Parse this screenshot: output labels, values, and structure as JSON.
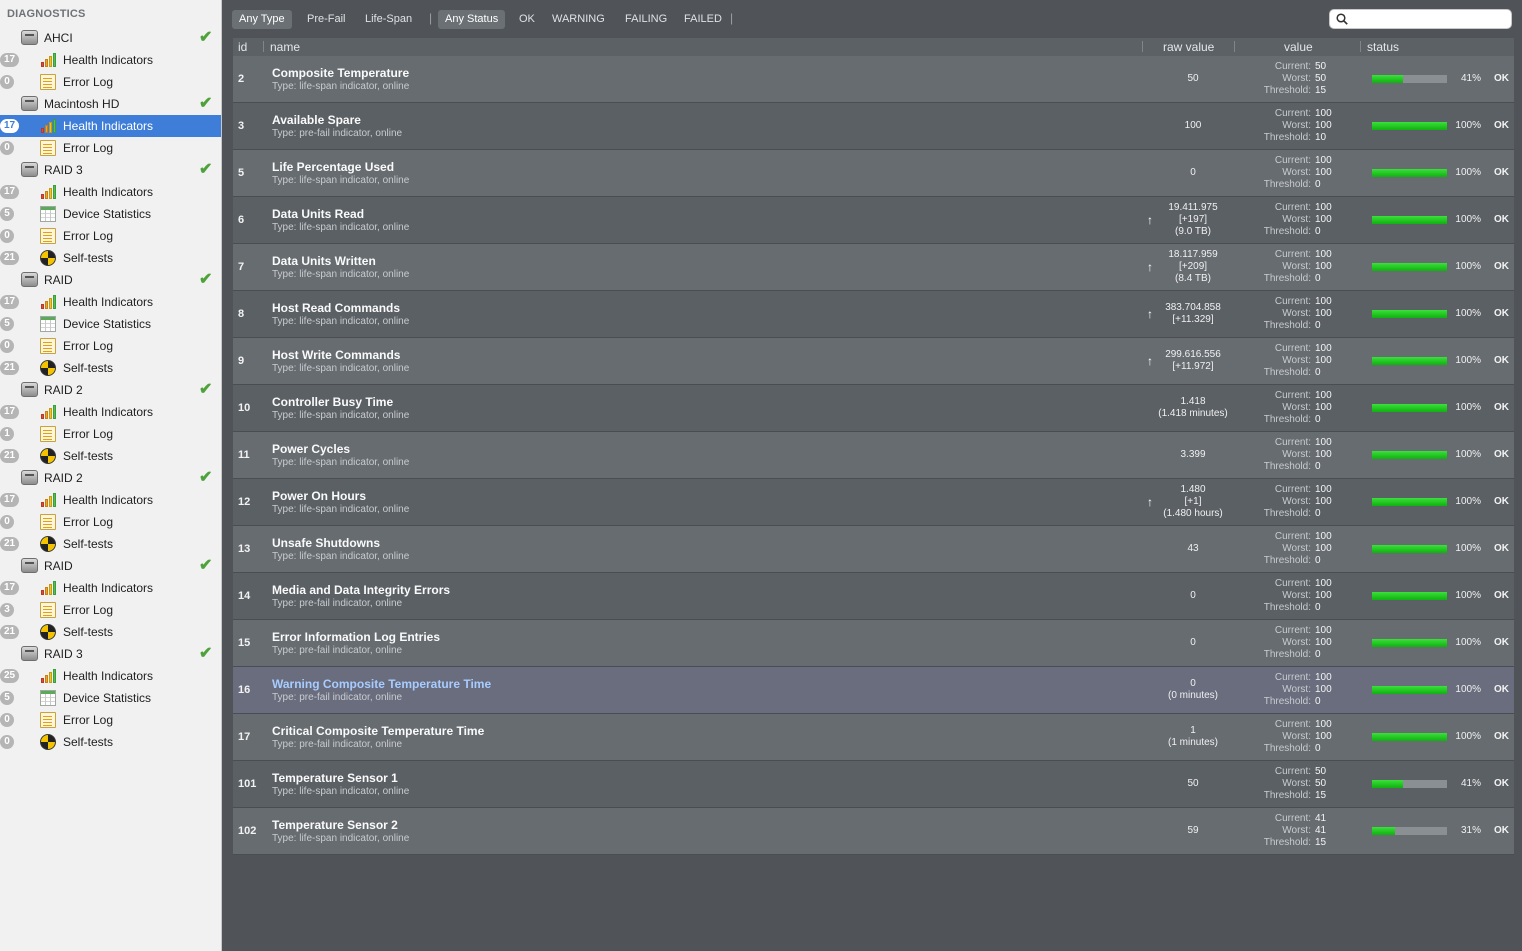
{
  "sidebar": {
    "title": "DIAGNOSTICS",
    "items": [
      {
        "kind": "disk",
        "label": "AHCI",
        "check": "✔"
      },
      {
        "kind": "child",
        "icon": "health",
        "label": "Health Indicators",
        "badge": "17"
      },
      {
        "kind": "child",
        "icon": "doc",
        "label": "Error Log",
        "badge": "0"
      },
      {
        "kind": "disk",
        "label": "Macintosh HD",
        "check": "✔"
      },
      {
        "kind": "child",
        "icon": "health",
        "label": "Health Indicators",
        "badge": "17",
        "selected": true
      },
      {
        "kind": "child",
        "icon": "doc",
        "label": "Error Log",
        "badge": "0"
      },
      {
        "kind": "disk",
        "label": "RAID 3",
        "check": "✔"
      },
      {
        "kind": "child",
        "icon": "health",
        "label": "Health Indicators",
        "badge": "17"
      },
      {
        "kind": "child",
        "icon": "stats",
        "label": "Device Statistics",
        "badge": "5"
      },
      {
        "kind": "child",
        "icon": "doc",
        "label": "Error Log",
        "badge": "0"
      },
      {
        "kind": "child",
        "icon": "self",
        "label": "Self-tests",
        "badge": "21"
      },
      {
        "kind": "disk",
        "label": "RAID",
        "check": "✔"
      },
      {
        "kind": "child",
        "icon": "health",
        "label": "Health Indicators",
        "badge": "17"
      },
      {
        "kind": "child",
        "icon": "stats",
        "label": "Device Statistics",
        "badge": "5"
      },
      {
        "kind": "child",
        "icon": "doc",
        "label": "Error Log",
        "badge": "0"
      },
      {
        "kind": "child",
        "icon": "self",
        "label": "Self-tests",
        "badge": "21"
      },
      {
        "kind": "disk",
        "label": "RAID 2",
        "check": "✔"
      },
      {
        "kind": "child",
        "icon": "health",
        "label": "Health Indicators",
        "badge": "17"
      },
      {
        "kind": "child",
        "icon": "doc",
        "label": "Error Log",
        "badge": "1"
      },
      {
        "kind": "child",
        "icon": "self",
        "label": "Self-tests",
        "badge": "21"
      },
      {
        "kind": "disk",
        "label": "RAID 2",
        "check": "✔"
      },
      {
        "kind": "child",
        "icon": "health",
        "label": "Health Indicators",
        "badge": "17"
      },
      {
        "kind": "child",
        "icon": "doc",
        "label": "Error Log",
        "badge": "0"
      },
      {
        "kind": "child",
        "icon": "self",
        "label": "Self-tests",
        "badge": "21"
      },
      {
        "kind": "disk",
        "label": "RAID",
        "check": "✔"
      },
      {
        "kind": "child",
        "icon": "health",
        "label": "Health Indicators",
        "badge": "17"
      },
      {
        "kind": "child",
        "icon": "doc",
        "label": "Error Log",
        "badge": "3"
      },
      {
        "kind": "child",
        "icon": "self",
        "label": "Self-tests",
        "badge": "21"
      },
      {
        "kind": "disk",
        "label": "RAID 3",
        "check": "✔"
      },
      {
        "kind": "child",
        "icon": "health",
        "label": "Health Indicators",
        "badge": "25"
      },
      {
        "kind": "child",
        "icon": "stats",
        "label": "Device Statistics",
        "badge": "5"
      },
      {
        "kind": "child",
        "icon": "doc",
        "label": "Error Log",
        "badge": "0"
      },
      {
        "kind": "child",
        "icon": "self",
        "label": "Self-tests",
        "badge": "0"
      }
    ]
  },
  "toolbar": {
    "type_filters": [
      "Any Type",
      "Pre-Fail",
      "Life-Span"
    ],
    "type_active": "Any Type",
    "status_filters": [
      "Any Status",
      "OK",
      "WARNING",
      "FAILING",
      "FAILED"
    ],
    "status_active": "Any Status",
    "separator": "|",
    "search": {
      "value": "",
      "placeholder": ""
    }
  },
  "table": {
    "columns": {
      "id": "id",
      "name": "name",
      "raw": "raw value",
      "value": "value",
      "status": "status"
    },
    "value_labels": [
      "Current:",
      "Worst:",
      "Threshold:"
    ],
    "rows": [
      {
        "id": "2",
        "name": "Composite Temperature",
        "type": "Type: life-span indicator, online",
        "raw": [
          "50"
        ],
        "arrow": false,
        "current": "50",
        "worst": "50",
        "threshold": "15",
        "pct": 41,
        "pct_label": "41%",
        "status": "OK"
      },
      {
        "id": "3",
        "name": "Available Spare",
        "type": "Type: pre-fail indicator, online",
        "raw": [
          "100"
        ],
        "arrow": false,
        "current": "100",
        "worst": "100",
        "threshold": "10",
        "pct": 100,
        "pct_label": "100%",
        "status": "OK"
      },
      {
        "id": "5",
        "name": "Life Percentage Used",
        "type": "Type: life-span indicator, online",
        "raw": [
          "0"
        ],
        "arrow": false,
        "current": "100",
        "worst": "100",
        "threshold": "0",
        "pct": 100,
        "pct_label": "100%",
        "status": "OK"
      },
      {
        "id": "6",
        "name": "Data Units Read",
        "type": "Type: life-span indicator, online",
        "raw": [
          "19.411.975",
          "[+197]",
          "(9.0 TB)"
        ],
        "arrow": true,
        "current": "100",
        "worst": "100",
        "threshold": "0",
        "pct": 100,
        "pct_label": "100%",
        "status": "OK"
      },
      {
        "id": "7",
        "name": "Data Units Written",
        "type": "Type: life-span indicator, online",
        "raw": [
          "18.117.959",
          "[+209]",
          "(8.4 TB)"
        ],
        "arrow": true,
        "current": "100",
        "worst": "100",
        "threshold": "0",
        "pct": 100,
        "pct_label": "100%",
        "status": "OK"
      },
      {
        "id": "8",
        "name": "Host Read Commands",
        "type": "Type: life-span indicator, online",
        "raw": [
          "383.704.858",
          "[+11.329]"
        ],
        "arrow": true,
        "current": "100",
        "worst": "100",
        "threshold": "0",
        "pct": 100,
        "pct_label": "100%",
        "status": "OK"
      },
      {
        "id": "9",
        "name": "Host Write Commands",
        "type": "Type: life-span indicator, online",
        "raw": [
          "299.616.556",
          "[+11.972]"
        ],
        "arrow": true,
        "current": "100",
        "worst": "100",
        "threshold": "0",
        "pct": 100,
        "pct_label": "100%",
        "status": "OK"
      },
      {
        "id": "10",
        "name": "Controller Busy Time",
        "type": "Type: life-span indicator, online",
        "raw": [
          "1.418",
          "(1.418 minutes)"
        ],
        "arrow": false,
        "current": "100",
        "worst": "100",
        "threshold": "0",
        "pct": 100,
        "pct_label": "100%",
        "status": "OK"
      },
      {
        "id": "11",
        "name": "Power Cycles",
        "type": "Type: life-span indicator, online",
        "raw": [
          "3.399"
        ],
        "arrow": false,
        "current": "100",
        "worst": "100",
        "threshold": "0",
        "pct": 100,
        "pct_label": "100%",
        "status": "OK"
      },
      {
        "id": "12",
        "name": "Power On Hours",
        "type": "Type: life-span indicator, online",
        "raw": [
          "1.480",
          "[+1]",
          "(1.480 hours)"
        ],
        "arrow": true,
        "current": "100",
        "worst": "100",
        "threshold": "0",
        "pct": 100,
        "pct_label": "100%",
        "status": "OK"
      },
      {
        "id": "13",
        "name": "Unsafe Shutdowns",
        "type": "Type: life-span indicator, online",
        "raw": [
          "43"
        ],
        "arrow": false,
        "current": "100",
        "worst": "100",
        "threshold": "0",
        "pct": 100,
        "pct_label": "100%",
        "status": "OK"
      },
      {
        "id": "14",
        "name": "Media and Data Integrity Errors",
        "type": "Type: pre-fail indicator, online",
        "raw": [
          "0"
        ],
        "arrow": false,
        "current": "100",
        "worst": "100",
        "threshold": "0",
        "pct": 100,
        "pct_label": "100%",
        "status": "OK"
      },
      {
        "id": "15",
        "name": "Error Information Log Entries",
        "type": "Type: pre-fail indicator, online",
        "raw": [
          "0"
        ],
        "arrow": false,
        "current": "100",
        "worst": "100",
        "threshold": "0",
        "pct": 100,
        "pct_label": "100%",
        "status": "OK"
      },
      {
        "id": "16",
        "name": "Warning Composite Temperature Time",
        "type": "Type: pre-fail indicator, online",
        "raw": [
          "0",
          "(0 minutes)"
        ],
        "arrow": false,
        "current": "100",
        "worst": "100",
        "threshold": "0",
        "pct": 100,
        "pct_label": "100%",
        "status": "OK",
        "highlight": true
      },
      {
        "id": "17",
        "name": "Critical Composite Temperature Time",
        "type": "Type: pre-fail indicator, online",
        "raw": [
          "1",
          "(1 minutes)"
        ],
        "arrow": false,
        "current": "100",
        "worst": "100",
        "threshold": "0",
        "pct": 100,
        "pct_label": "100%",
        "status": "OK"
      },
      {
        "id": "101",
        "name": "Temperature Sensor 1",
        "type": "Type: life-span indicator, online",
        "raw": [
          "50"
        ],
        "arrow": false,
        "current": "50",
        "worst": "50",
        "threshold": "15",
        "pct": 41,
        "pct_label": "41%",
        "status": "OK"
      },
      {
        "id": "102",
        "name": "Temperature Sensor 2",
        "type": "Type: life-span indicator, online",
        "raw": [
          "59"
        ],
        "arrow": false,
        "current": "41",
        "worst": "41",
        "threshold": "15",
        "pct": 31,
        "pct_label": "31%",
        "status": "OK"
      }
    ]
  },
  "colors": {
    "bar_fill": "#1ec81e",
    "selection": "#3f7ed8",
    "check": "#4fa23a",
    "link_name": "#a8ccff"
  }
}
